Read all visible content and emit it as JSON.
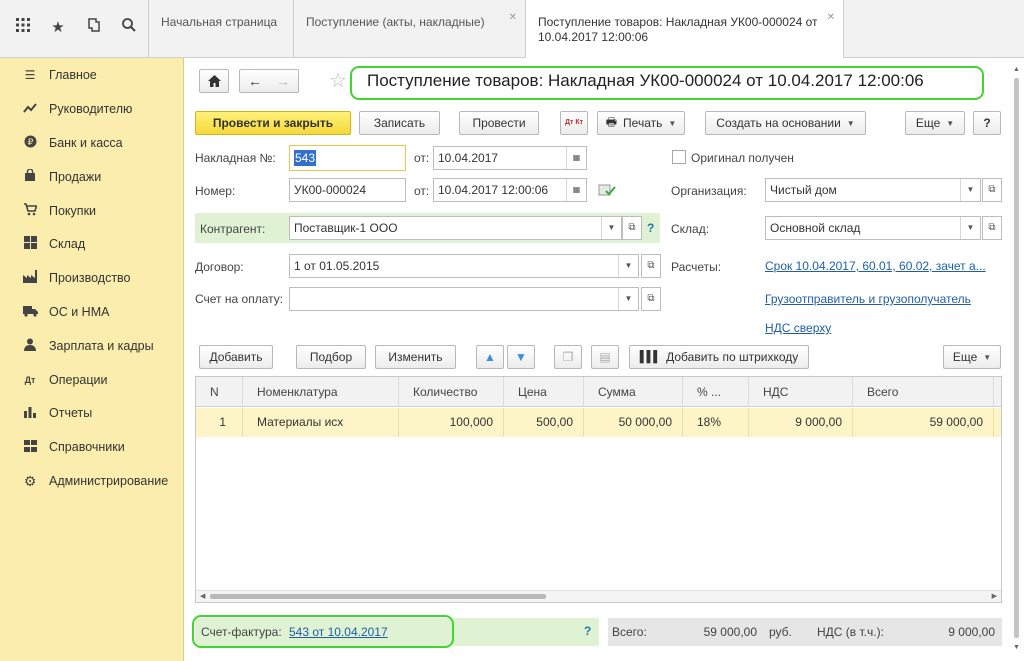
{
  "topbar": {
    "tabs": [
      {
        "label": "Начальная страница"
      },
      {
        "label": "Поступление (акты, накладные)"
      },
      {
        "label": "Поступление товаров: Накладная УК00-000024 от 10.04.2017 12:00:06"
      }
    ],
    "icons": [
      "apps-grid-icon",
      "favorites-star-icon",
      "history-icon",
      "search-icon"
    ]
  },
  "sidebar": {
    "items": [
      {
        "label": "Главное",
        "icon": "menu-lines-icon"
      },
      {
        "label": "Руководителю",
        "icon": "trend-chart-icon"
      },
      {
        "label": "Банк и касса",
        "icon": "ruble-coin-icon"
      },
      {
        "label": "Продажи",
        "icon": "shopping-bag-icon"
      },
      {
        "label": "Покупки",
        "icon": "shopping-cart-icon"
      },
      {
        "label": "Склад",
        "icon": "warehouse-grid-icon"
      },
      {
        "label": "Производство",
        "icon": "factory-icon"
      },
      {
        "label": "ОС и НМА",
        "icon": "truck-icon"
      },
      {
        "label": "Зарплата и кадры",
        "icon": "person-icon"
      },
      {
        "label": "Операции",
        "icon": "debit-credit-icon"
      },
      {
        "label": "Отчеты",
        "icon": "bar-chart-icon"
      },
      {
        "label": "Справочники",
        "icon": "book-grid-icon"
      },
      {
        "label": "Администрирование",
        "icon": "gear-icon"
      }
    ]
  },
  "form": {
    "title": "Поступление товаров: Накладная УК00-000024 от 10.04.2017 12:00:06",
    "toolbar": {
      "post_close": "Провести и закрыть",
      "save": "Записать",
      "post": "Провести",
      "dt_kt": "Дт Кт",
      "print": "Печать",
      "create_based": "Создать на основании",
      "more": "Еще",
      "help": "?"
    },
    "invoice_no_label": "Накладная №:",
    "invoice_no_value": "543",
    "from_label": "от:",
    "invoice_date": "10.04.2017",
    "number_label": "Номер:",
    "number_value": "УК00-000024",
    "number_date": "10.04.2017 12:00:06",
    "original_received": "Оригинал получен",
    "organization_label": "Организация:",
    "organization_value": "Чистый дом",
    "counterparty_label": "Контрагент:",
    "counterparty_value": "Поставщик-1 ООО",
    "warehouse_label": "Склад:",
    "warehouse_value": "Основной склад",
    "contract_label": "Договор:",
    "contract_value": "1 от 01.05.2015",
    "settlements_label": "Расчеты:",
    "settlements_link": "Срок 10.04.2017, 60.01, 60.02, зачет а...",
    "payment_invoice_label": "Счет на оплату:",
    "payment_invoice_value": "",
    "shipper_link": "Грузоотправитель и грузополучатель",
    "vat_link": "НДС сверху",
    "help_q": "?"
  },
  "table_toolbar": {
    "add": "Добавить",
    "select": "Подбор",
    "change": "Изменить",
    "add_barcode": "Добавить по штрихкоду",
    "more": "Еще"
  },
  "table": {
    "columns": [
      "N",
      "Номенклатура",
      "Количество",
      "Цена",
      "Сумма",
      "% ...",
      "НДС",
      "Всего"
    ],
    "rows": [
      {
        "n": "1",
        "item": "Материалы исх",
        "qty": "100,000",
        "price": "500,00",
        "sum": "50 000,00",
        "vat_rate": "18%",
        "vat": "9 000,00",
        "total": "59 000,00"
      }
    ]
  },
  "footer": {
    "invoice_label": "Счет-фактура:",
    "invoice_link": "543 от 10.04.2017",
    "help_q": "?",
    "total_label": "Всего:",
    "total_value": "59 000,00",
    "currency": "руб.",
    "vat_label": "НДС (в т.ч.):",
    "vat_value": "9 000,00"
  },
  "colors": {
    "sidebar_bg": "#fbedad",
    "highlight_green": "#42d431",
    "primary_button": "#f5d93a",
    "link": "#1f5fa8"
  }
}
